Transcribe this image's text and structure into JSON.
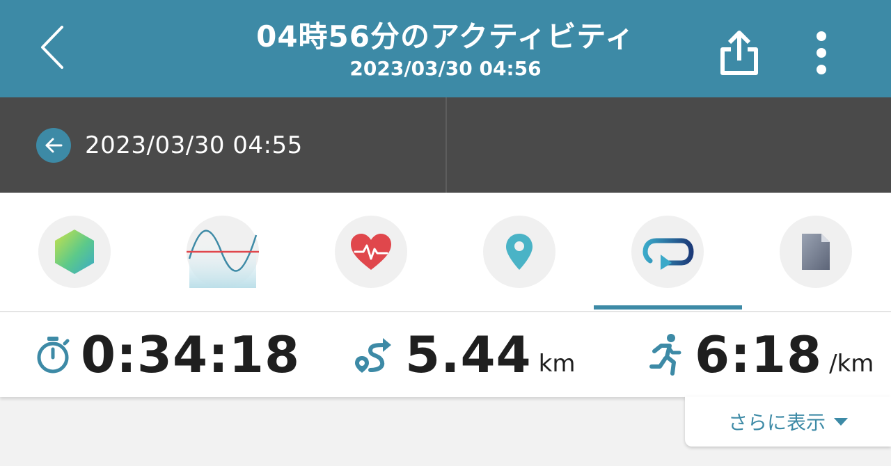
{
  "header": {
    "title": "04時56分のアクティビティ",
    "subtitle": "2023/03/30 04:56",
    "background": "#3d8aa6",
    "back_icon": "chevron-left-icon",
    "share_icon": "share-icon",
    "more_icon": "more-vertical-icon"
  },
  "segments": {
    "previous_label": "2023/03/30 04:55",
    "previous_icon": "arrow-left-icon"
  },
  "tabs": [
    {
      "name": "summary",
      "icon": "hexagon-icon"
    },
    {
      "name": "graph",
      "icon": "wave-graph-icon"
    },
    {
      "name": "heart-rate",
      "icon": "heart-rate-icon"
    },
    {
      "name": "map",
      "icon": "map-pin-icon"
    },
    {
      "name": "laps",
      "icon": "laps-icon",
      "selected": true
    },
    {
      "name": "file",
      "icon": "file-icon"
    }
  ],
  "stats": {
    "time": {
      "value": "0:34:18",
      "icon": "stopwatch-icon"
    },
    "distance": {
      "value": "5.44",
      "unit": "km",
      "icon": "route-icon"
    },
    "pace": {
      "value": "6:18",
      "unit": "/km",
      "icon": "runner-icon"
    }
  },
  "more_button": {
    "label": "さらに表示",
    "icon": "caret-down-icon"
  },
  "colors": {
    "accent": "#3d8aa6",
    "dark_bar": "#4a4a4a",
    "heart": "#e0474c"
  }
}
